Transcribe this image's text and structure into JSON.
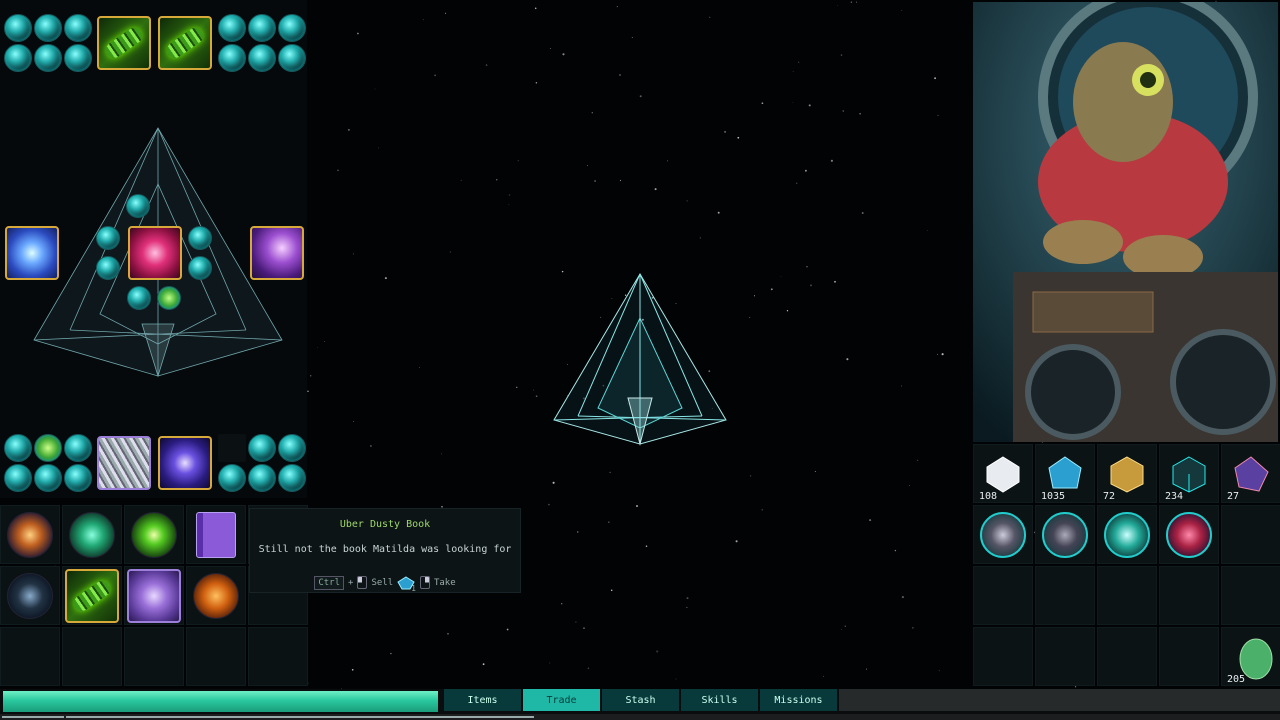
{
  "tooltip": {
    "title": "Uber Dusty Book",
    "description": "Still not the book Matilda was looking for",
    "ctrl_key": "Ctrl",
    "plus": "+",
    "sell_label": "Sell",
    "sell_price": "1",
    "take_label": "Take"
  },
  "resources": [
    {
      "name": "white-crystal",
      "count": "108",
      "color": "#e8ecf0"
    },
    {
      "name": "blue-crystal",
      "count": "1035",
      "color": "#2a9fd0"
    },
    {
      "name": "gold-dice",
      "count": "72",
      "color": "#c79a3c"
    },
    {
      "name": "cyan-cube",
      "count": "234",
      "color": "#26c4c8"
    },
    {
      "name": "rainbow-shard",
      "count": "27",
      "color": "#a060e0"
    }
  ],
  "egg": {
    "count": "205"
  },
  "tabs": [
    {
      "label": "Items",
      "active": false
    },
    {
      "label": "Trade",
      "active": true
    },
    {
      "label": "Stash",
      "active": false
    },
    {
      "label": "Skills",
      "active": false
    },
    {
      "label": "Missions",
      "active": false
    }
  ],
  "progress": {
    "fill_fraction": 0.34
  }
}
